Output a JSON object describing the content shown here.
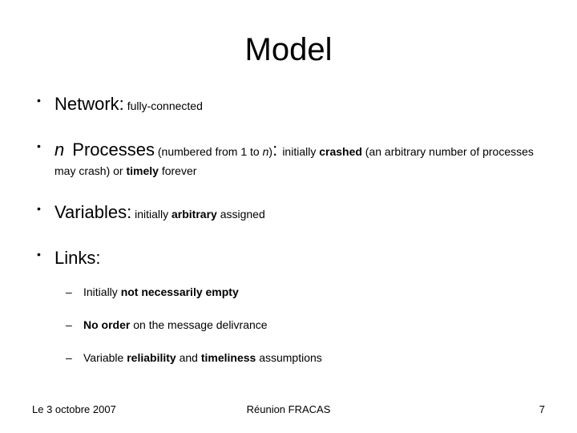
{
  "title": "Model",
  "bullets": {
    "network": {
      "label": "Network:",
      "text": "fully-connected"
    },
    "processes": {
      "n": "n",
      "label": "Processes",
      "paren_pre": "(numbered from 1 to ",
      "paren_n": "n",
      "paren_post": ")",
      "colon": ": ",
      "text_a": "initially ",
      "crashed": "crashed",
      "text_b": " (an arbitrary number of processes may crash) or ",
      "timely": "timely",
      "text_c": " forever"
    },
    "variables": {
      "label": "Variables:",
      "text_a": "initially ",
      "arb": "arbitrary",
      "text_b": " assigned"
    },
    "links": {
      "label": "Links:",
      "sub": [
        {
          "pre": "Initially ",
          "bold": "not necessarily empty",
          "post": ""
        },
        {
          "pre": "",
          "bold": "No order",
          "post": " on the message delivrance"
        },
        {
          "pre": "Variable ",
          "bold": "reliability",
          "mid": " and ",
          "bold2": "timeliness",
          "post": " assumptions"
        }
      ]
    }
  },
  "footer": {
    "left": "Le 3 octobre 2007",
    "center": "Réunion FRACAS",
    "right": "7"
  }
}
